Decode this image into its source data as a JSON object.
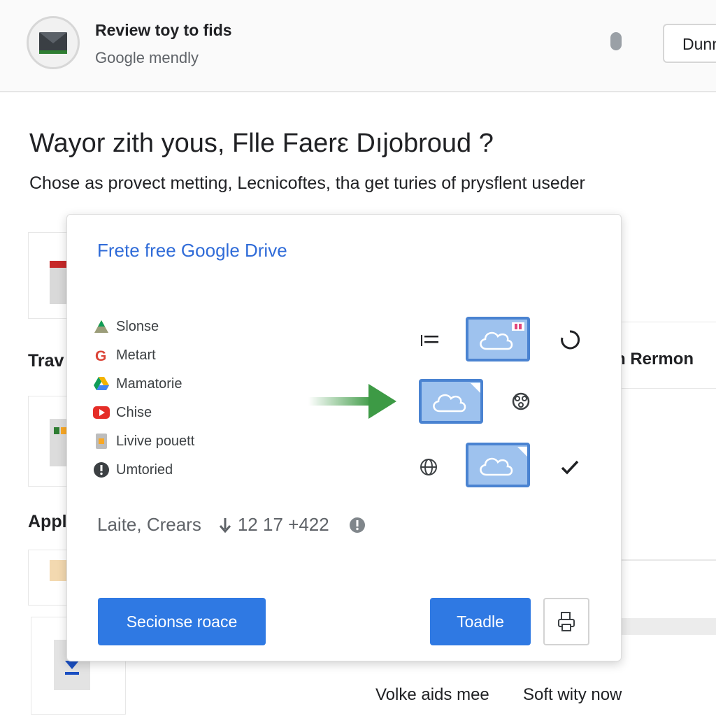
{
  "header": {
    "title": "Review toy to fids",
    "subtitle": "Google mendly",
    "button_label": "Dunn"
  },
  "page": {
    "heading": "Wayor zith yous, Flle Faerε Dıjobroud ?",
    "subheading": "Chose as provect metting, Lecnicoftes, tha get turies of prysflent useder"
  },
  "background": {
    "left_label_1": "Trav",
    "left_label_2": "Appl",
    "right_label": "n Rermon",
    "footer_left": "Volke aids mee",
    "footer_right": "Soft wity now"
  },
  "dialog": {
    "title": "Frete free Google Drive",
    "services": [
      {
        "label": "Slonse",
        "icon": "drive-triangle-icon"
      },
      {
        "label": "Metart",
        "icon": "google-g-icon"
      },
      {
        "label": "Mamatorie",
        "icon": "drive-logo-icon"
      },
      {
        "label": "Chise",
        "icon": "youtube-icon"
      },
      {
        "label": "Livive pouett",
        "icon": "file-icon"
      },
      {
        "label": "Umtoried",
        "icon": "info-circle-icon"
      }
    ],
    "meta": {
      "label": "Laite, Crears",
      "count": "12 17 +422"
    },
    "primary_button": "Secionse roace",
    "secondary_button": "Toadle"
  },
  "colors": {
    "accent_blue": "#2f79e3",
    "title_blue": "#2f6bd8",
    "cloud_fill": "#9ec2ee",
    "cloud_border": "#4a83d1",
    "arrow_green": "#3d9a45"
  }
}
